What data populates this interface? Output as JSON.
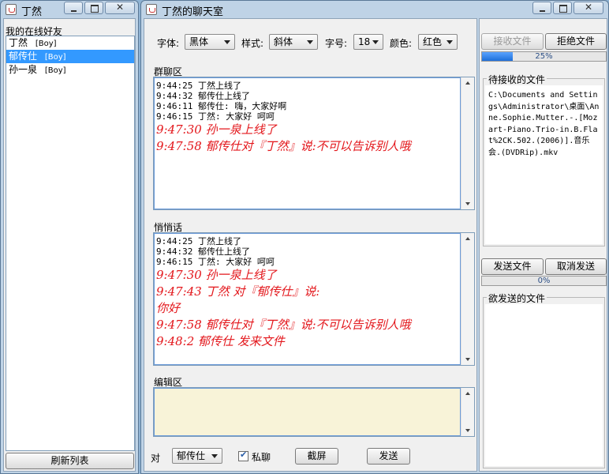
{
  "friends_window": {
    "title": "丁然",
    "list_header": "我的在线好友",
    "friends": [
      {
        "name": "丁然",
        "tag": "[Boy]"
      },
      {
        "name": "郁传仕",
        "tag": "[Boy]"
      },
      {
        "name": "孙一泉",
        "tag": "[Boy]"
      }
    ],
    "refresh_label": "刷新列表"
  },
  "chat_window": {
    "title": "丁然的聊天室",
    "font_label": "字体:",
    "font_value": "黑体",
    "style_label": "样式:",
    "style_value": "斜体",
    "size_label": "字号:",
    "size_value": "18",
    "color_label": "颜色:",
    "color_value": "红色",
    "group_label": "群聊区",
    "group_messages_small": [
      "9:44:25 丁然上线了",
      "9:44:32 郁传仕上线了",
      "9:46:11 郁传仕: 嗨，大家好啊",
      "9:46:15 丁然: 大家好  呵呵"
    ],
    "group_messages_big": [
      "9:47:30 孙一泉上线了",
      "9:47:58 郁传仕对『丁然』说:不可以告诉别人哦"
    ],
    "whisper_label": "悄悄话",
    "whisper_messages_small": [
      "9:44:25 丁然上线了",
      "9:44:32 郁传仕上线了",
      "9:46:15 丁然: 大家好  呵呵"
    ],
    "whisper_messages_big": [
      "9:47:30 孙一泉上线了",
      "9:47:43 丁然 对『郁传仕』说:",
      "你好",
      "9:47:58 郁传仕对『丁然』说:不可以告诉别人哦",
      "9:48:2 郁传仕 发来文件"
    ],
    "edit_label": "编辑区",
    "to_label": "对",
    "to_value": "郁传仕",
    "private_label": "私聊",
    "screenshot_label": "截屏",
    "send_label": "发送",
    "accept_file_label": "接收文件",
    "reject_file_label": "拒绝文件",
    "receive_progress_text": "25%",
    "receive_progress": 0.25,
    "pending_receive_label": "待接收的文件",
    "pending_receive_file": "C:\\Documents and Settings\\Administrator\\桌面\\Anne.Sophie.Mutter.-.[Mozart-Piano.Trio-in.B.Flat%2CK.502.(2006)].音乐会.(DVDRip).mkv",
    "send_file_label": "发送文件",
    "cancel_send_label": "取消发送",
    "send_progress_text": "0%",
    "send_progress": 0,
    "pending_send_label": "欲发送的文件"
  },
  "colors": {
    "message_red": "#e3161b",
    "selection_blue": "#3399ff",
    "progress_blue": "#1e6fd9",
    "edit_bg": "#f8f3d8"
  }
}
